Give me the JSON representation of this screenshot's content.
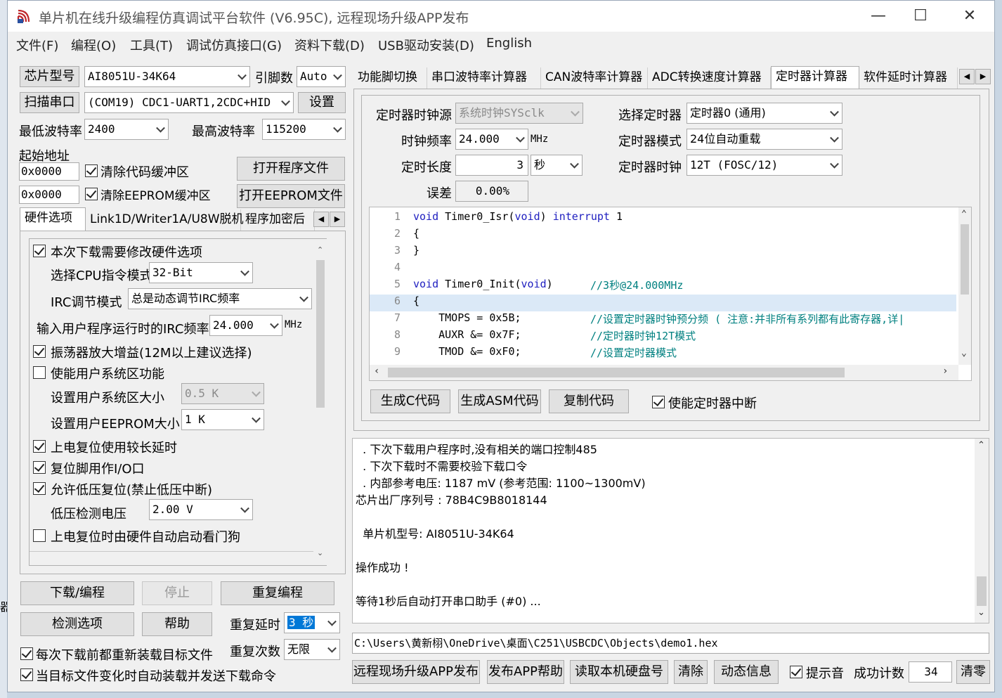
{
  "window": {
    "title": "单片机在线升级编程仿真调试平台软件 (V6.95C), 远程现场升级APP发布"
  },
  "menu": [
    "文件(F)",
    "编程(O)",
    "工具(T)",
    "调试仿真接口(G)",
    "资料下载(D)",
    "USB驱动安装(D)",
    "English"
  ],
  "left": {
    "chip_type_button": "芯片型号",
    "chip_model": "AI8051U-34K64",
    "pin_count_label": "引脚数",
    "pin_count": "Auto",
    "scan_port_button": "扫描串口",
    "com_port": "(COM19) CDC1-UART1,2CDC+HID",
    "settings_button": "设置",
    "min_baud_label": "最低波特率",
    "min_baud": "2400",
    "max_baud_label": "最高波特率",
    "max_baud": "115200",
    "start_addr_label": "起始地址",
    "code_addr": "0x0000",
    "clear_code_label": "清除代码缓冲区",
    "open_program_button": "打开程序文件",
    "eeprom_addr": "0x0000",
    "clear_eeprom_label": "清除EEPROM缓冲区",
    "open_eeprom_button": "打开EEPROM文件",
    "tabs": [
      "硬件选项",
      "Link1D/Writer1A/U8W脱机",
      "程序加密后"
    ],
    "hw": {
      "modify_hw_label": "本次下载需要修改硬件选项",
      "cpu_mode_label": "选择CPU指令模式",
      "cpu_mode": "32-Bit",
      "irc_mode_label": "IRC调节模式",
      "irc_mode": "总是动态调节IRC频率",
      "irc_freq_label": "输入用户程序运行时的IRC频率",
      "irc_freq": "24.000",
      "irc_unit": "MHz",
      "osc_gain_label": "振荡器放大增益(12M以上建议选择)",
      "user_sys_label": "使能用户系统区功能",
      "user_sys_size_label": "设置用户系统区大小",
      "user_sys_size": "0.5 K",
      "user_eeprom_label": "设置用户EEPROM大小",
      "user_eeprom_size": "1   K",
      "long_delay_label": "上电复位使用较长延时",
      "reset_io_label": "复位脚用作I/O口",
      "lvd_label": "允许低压复位(禁止低压中断)",
      "lvd_volt_label": "低压检测电压",
      "lvd_volt": "2.00 V",
      "wdt_label": "上电复位时由硬件自动启动看门狗"
    },
    "download_button": "下载/编程",
    "stop_button": "停止",
    "reprogram_button": "重复编程",
    "check_options_button": "检测选项",
    "help_button": "帮助",
    "repeat_delay_label": "重复延时",
    "repeat_delay": "3 秒",
    "repeat_count_label": "重复次数",
    "repeat_count": "无限",
    "reload_label": "每次下载前都重新装载目标文件",
    "auto_reload_label": "当目标文件变化时自动装载并发送下载命令"
  },
  "right": {
    "tabs": [
      "功能脚切换",
      "串口波特率计算器",
      "CAN波特率计算器",
      "ADC转换速度计算器",
      "定时器计算器",
      "软件延时计算器"
    ],
    "active_tab": "定时器计算器",
    "timer": {
      "clock_src_label": "定时器时钟源",
      "clock_src": "系统时钟SYSclk",
      "select_timer_label": "选择定时器",
      "select_timer": "定时器0 (通用)",
      "clock_freq_label": "时钟频率",
      "clock_freq": "24.000",
      "clock_unit": "MHz",
      "timer_mode_label": "定时器模式",
      "timer_mode": "24位自动重载",
      "duration_label": "定时长度",
      "duration": "3",
      "duration_unit": "秒",
      "timer_clock_label": "定时器时钟",
      "timer_clock": "12T (FOSC/12)",
      "error_label": "误差",
      "error": "0.00%"
    },
    "code_lines": [
      {
        "n": "1",
        "code": "void Timer0_Isr(void) interrupt 1"
      },
      {
        "n": "2",
        "code": "{"
      },
      {
        "n": "3",
        "code": "}"
      },
      {
        "n": "4",
        "code": ""
      },
      {
        "n": "5",
        "code": "void Timer0_Init(void)",
        "comment": "//3秒@24.000MHz"
      },
      {
        "n": "6",
        "code": "{"
      },
      {
        "n": "7",
        "code": "    TMOPS = 0x5B;",
        "comment": "//设置定时器时钟预分频 ( 注意:并非所有系列都有此寄存器,详|"
      },
      {
        "n": "8",
        "code": "    AUXR &= 0x7F;",
        "comment": "//定时器时钟12T模式"
      },
      {
        "n": "9",
        "code": "    TMOD &= 0xF0;",
        "comment": "//设置定时器模式"
      }
    ],
    "gen_c_button": "生成C代码",
    "gen_asm_button": "生成ASM代码",
    "copy_button": "复制代码",
    "enable_irq_label": "使能定时器中断",
    "log": [
      "  . 下次下载用户程序时,没有相关的端口控制485",
      "  . 下次下载时不需要校验下载口令",
      "  . 内部参考电压: 1187 mV (参考范围: 1100~1300mV)",
      "芯片出厂序列号 : 78B4C9B8018144",
      "",
      "  单片机型号: AI8051U-34K64",
      "",
      "操作成功 !",
      "",
      "等待1秒后自动打开串口助手 (#0) ..."
    ],
    "file_path": "C:\\Users\\黄新栩\\OneDrive\\桌面\\C251\\USBCDC\\Objects\\demo1.hex",
    "remote_app_button": "远程现场升级APP发布",
    "app_help_button": "发布APP帮助",
    "read_disk_button": "读取本机硬盘号",
    "clear_button": "清除",
    "dynamic_info_button": "动态信息",
    "beep_label": "提示音",
    "success_count_label": "成功计数",
    "success_count": "34",
    "reset_count_button": "清零"
  }
}
